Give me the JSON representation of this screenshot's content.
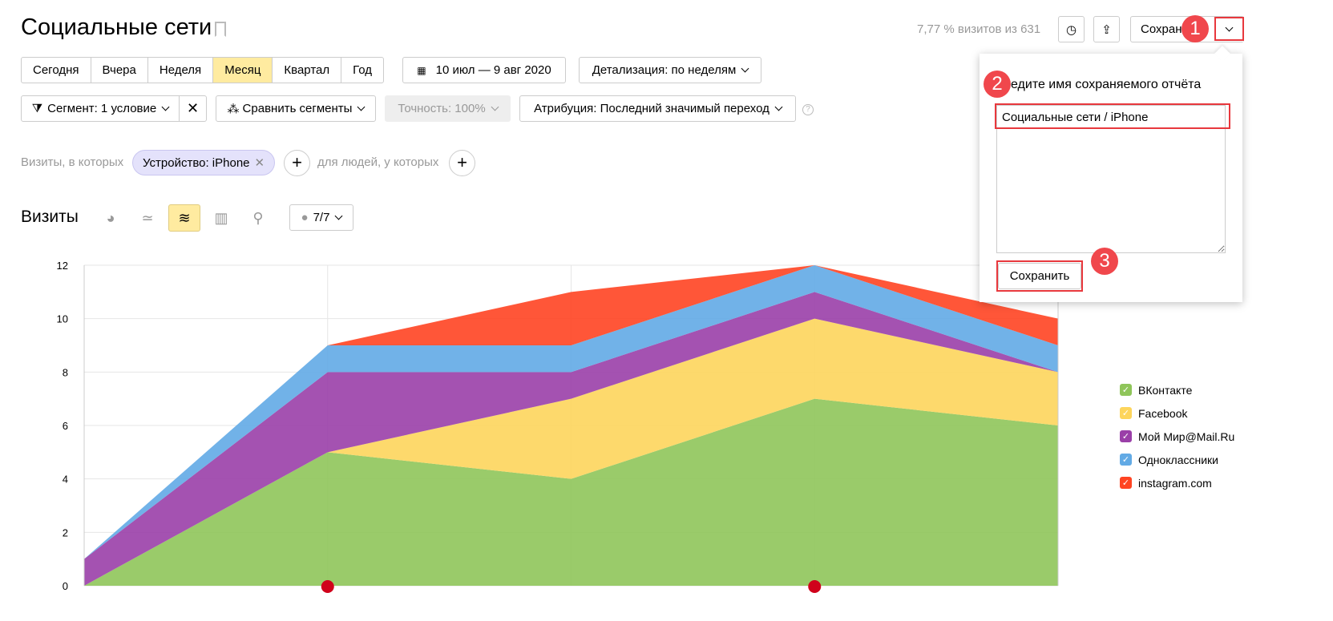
{
  "header": {
    "title": "Социальные сети",
    "stats": "7,77 % визитов из 631",
    "save_label": "Сохранить"
  },
  "periods": [
    "Сегодня",
    "Вчера",
    "Неделя",
    "Месяц",
    "Квартал",
    "Год"
  ],
  "date_range": "10 июл — 9 авг 2020",
  "detail": "Детализация: по неделям",
  "segment": "Сегмент: 1 условие",
  "compare": "Сравнить сегменты",
  "accuracy": "Точность: 100%",
  "attribution": "Атрибуция: Последний значимый переход",
  "filter": {
    "prefix": "Визиты, в которых",
    "chip": "Устройство: iPhone",
    "people": "для людей, у которых"
  },
  "chart_header": {
    "title": "Визиты",
    "notes": "7/7"
  },
  "popup": {
    "title": "Введите имя сохраняемого отчёта",
    "value": "Социальные сети / iPhone",
    "save": "Сохранить"
  },
  "badges": [
    "1",
    "2",
    "3"
  ],
  "chart_data": {
    "type": "area",
    "stacked": true,
    "ylim": [
      0,
      12
    ],
    "yticks": [
      0,
      2,
      4,
      6,
      8,
      10,
      12
    ],
    "x": [
      0,
      1,
      2,
      3,
      4
    ],
    "series": [
      {
        "name": "ВКонтакте",
        "color": "#8fc55a",
        "values": [
          0,
          5,
          4,
          7,
          6
        ]
      },
      {
        "name": "Facebook",
        "color": "#fdd55c",
        "values": [
          0,
          0,
          3,
          3,
          2
        ]
      },
      {
        "name": "Мой Мир@Mail.Ru",
        "color": "#9a3fa8",
        "values": [
          1,
          3,
          1,
          1,
          0
        ]
      },
      {
        "name": "Одноклассники",
        "color": "#62aae5",
        "values": [
          0,
          1,
          1,
          1,
          1
        ]
      },
      {
        "name": "instagram.com",
        "color": "#ff4422",
        "values": [
          0,
          0,
          2,
          0,
          1
        ]
      }
    ]
  }
}
